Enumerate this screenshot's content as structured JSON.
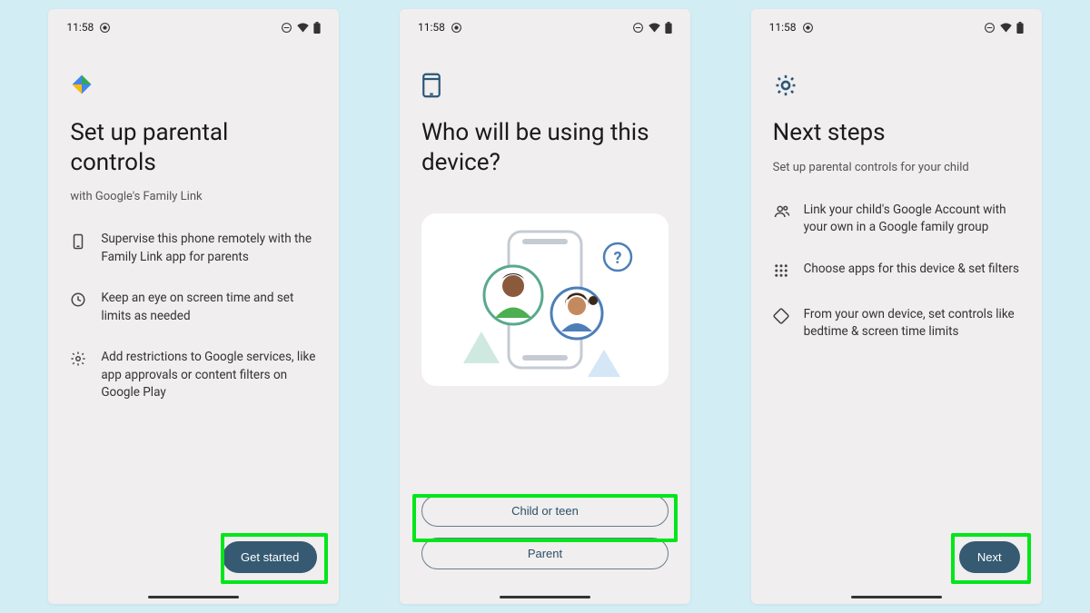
{
  "status_bar": {
    "time": "11:58"
  },
  "screen1": {
    "title": "Set up parental controls",
    "subtitle": "with Google's Family Link",
    "bullets": [
      "Supervise this phone remotely with the Family Link app for parents",
      "Keep an eye on screen time and set limits as needed",
      "Add restrictions to Google services, like app approvals or content filters on Google Play"
    ],
    "cta": "Get started"
  },
  "screen2": {
    "title": "Who will be using this device?",
    "option_child": "Child or teen",
    "option_parent": "Parent"
  },
  "screen3": {
    "title": "Next steps",
    "subtitle": "Set up parental controls for your child",
    "bullets": [
      "Link your child's Google Account with your own in a Google family group",
      "Choose apps for this device & set filters",
      "From your own device, set controls like bedtime & screen time limits"
    ],
    "cta": "Next"
  }
}
